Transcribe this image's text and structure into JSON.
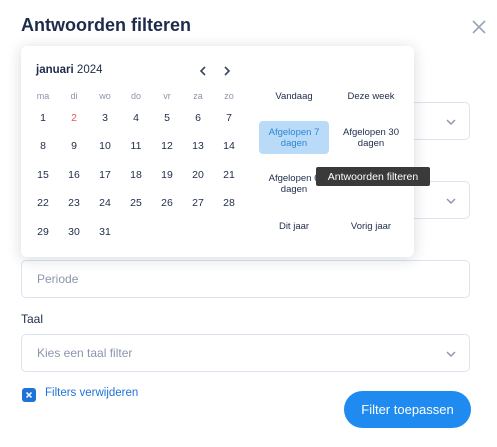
{
  "modal": {
    "title": "Antwoorden filteren"
  },
  "fields": {
    "periode_placeholder": "Periode",
    "taal_label": "Taal",
    "taal_placeholder": "Kies een taal filter"
  },
  "checkbox": {
    "label": "Filters verwijderen",
    "checked": true
  },
  "apply_button": "Filter toepassen",
  "picker": {
    "month": "januari",
    "year": "2024",
    "weekdays": [
      "ma",
      "di",
      "wo",
      "do",
      "vr",
      "za",
      "zo"
    ],
    "weeks": [
      [
        "1",
        "2",
        "3",
        "4",
        "5",
        "6",
        "7"
      ],
      [
        "8",
        "9",
        "10",
        "11",
        "12",
        "13",
        "14"
      ],
      [
        "15",
        "16",
        "17",
        "18",
        "19",
        "20",
        "21"
      ],
      [
        "22",
        "23",
        "24",
        "25",
        "26",
        "27",
        "28"
      ],
      [
        "29",
        "30",
        "31"
      ]
    ],
    "today": "2",
    "presets": [
      [
        "Vandaag",
        "Deze week"
      ],
      [
        "Afgelopen 7 dagen",
        "Afgelopen 30 dagen"
      ],
      [
        "Afgelopen 6 dagen",
        ""
      ],
      [
        "Dit jaar",
        "Vorig jaar"
      ]
    ],
    "active_preset": "Afgelopen 7 dagen"
  },
  "tooltip": "Antwoorden filteren",
  "colors": {
    "accent": "#1f8af0",
    "text": "#1e2b4a",
    "muted": "#8a95ad",
    "today": "#e05a5a"
  }
}
